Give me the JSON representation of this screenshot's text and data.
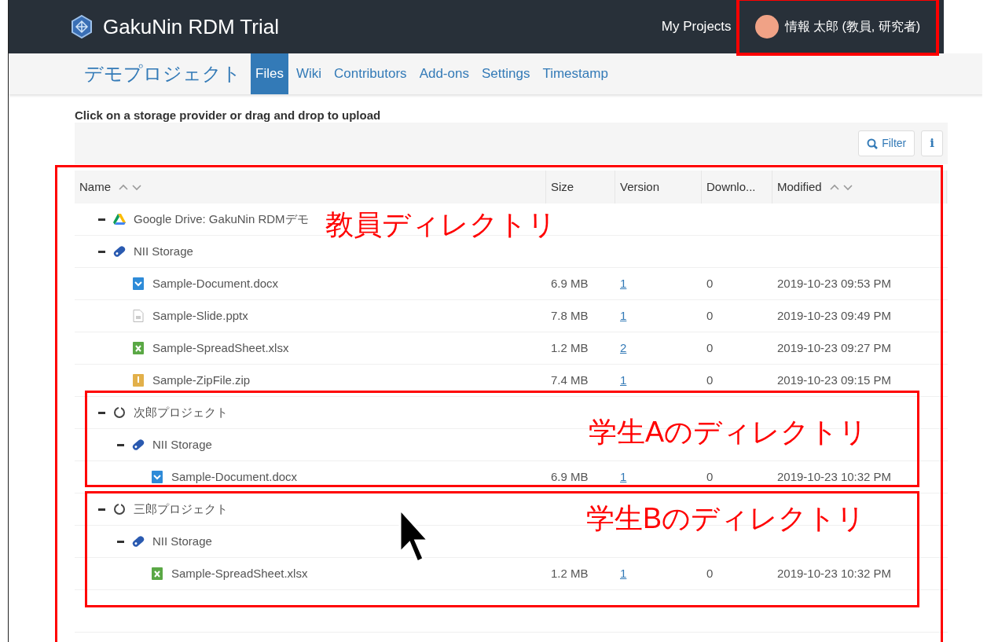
{
  "navbar": {
    "brand": "GakuNin RDM Trial",
    "links": [
      "My Projects"
    ],
    "user": {
      "name": "情報 太郎 (教員, 研究者)",
      "highlighted": true
    }
  },
  "project_nav": {
    "title": "デモプロジェクト",
    "tabs": [
      {
        "label": "Files",
        "selected": true
      },
      {
        "label": "Wiki",
        "selected": false
      },
      {
        "label": "Contributors",
        "selected": false
      },
      {
        "label": "Add-ons",
        "selected": false
      },
      {
        "label": "Settings",
        "selected": false
      },
      {
        "label": "Timestamp",
        "selected": false
      }
    ]
  },
  "upload_hint": "Click on a storage provider or drag and drop to upload",
  "toolbar": {
    "filter": "Filter",
    "info": "i"
  },
  "table": {
    "columns": [
      {
        "label": "Name",
        "sortable": true
      },
      {
        "label": "Size",
        "sortable": false
      },
      {
        "label": "Version",
        "sortable": false
      },
      {
        "label": "Downlo...",
        "sortable": false
      },
      {
        "label": "Modified",
        "sortable": true
      }
    ],
    "rows": [
      {
        "kind": "google-drive",
        "name": "Google Drive: GakuNin RDMデモ",
        "expanded": true
      },
      {
        "kind": "storage",
        "name": "NII Storage",
        "expanded": true,
        "children": [
          {
            "kind": "docx",
            "name": "Sample-Document.docx",
            "size": "6.9 MB",
            "version": "1",
            "downloads": "0",
            "modified": "2019-10-23 09:53 PM"
          },
          {
            "kind": "pptx",
            "name": "Sample-Slide.pptx",
            "size": "7.8 MB",
            "version": "1",
            "downloads": "0",
            "modified": "2019-10-23 09:49 PM"
          },
          {
            "kind": "xlsx",
            "name": "Sample-SpreadSheet.xlsx",
            "size": "1.2 MB",
            "version": "2",
            "downloads": "0",
            "modified": "2019-10-23 09:27 PM"
          },
          {
            "kind": "zip",
            "name": "Sample-ZipFile.zip",
            "size": "7.4 MB",
            "version": "1",
            "downloads": "0",
            "modified": "2019-10-23 09:15 PM"
          }
        ]
      },
      {
        "kind": "project",
        "name": "次郎プロジェクト",
        "expanded": true,
        "children": [
          {
            "kind": "storage",
            "name": "NII Storage",
            "expanded": true,
            "children": [
              {
                "kind": "docx",
                "name": "Sample-Document.docx",
                "size": "6.9 MB",
                "version": "1",
                "downloads": "0",
                "modified": "2019-10-23 10:32 PM"
              }
            ]
          }
        ]
      },
      {
        "kind": "project",
        "name": "三郎プロジェクト",
        "expanded": true,
        "children": [
          {
            "kind": "storage",
            "name": "NII Storage",
            "expanded": true,
            "children": [
              {
                "kind": "xlsx",
                "name": "Sample-SpreadSheet.xlsx",
                "size": "1.2 MB",
                "version": "1",
                "downloads": "0",
                "modified": "2019-10-23 10:32 PM"
              }
            ]
          }
        ]
      }
    ]
  },
  "annotations": [
    {
      "label": "教員ディレクトリ"
    },
    {
      "label": "学生Aのディレクトリ"
    },
    {
      "label": "学生Bのディレクトリ"
    }
  ]
}
